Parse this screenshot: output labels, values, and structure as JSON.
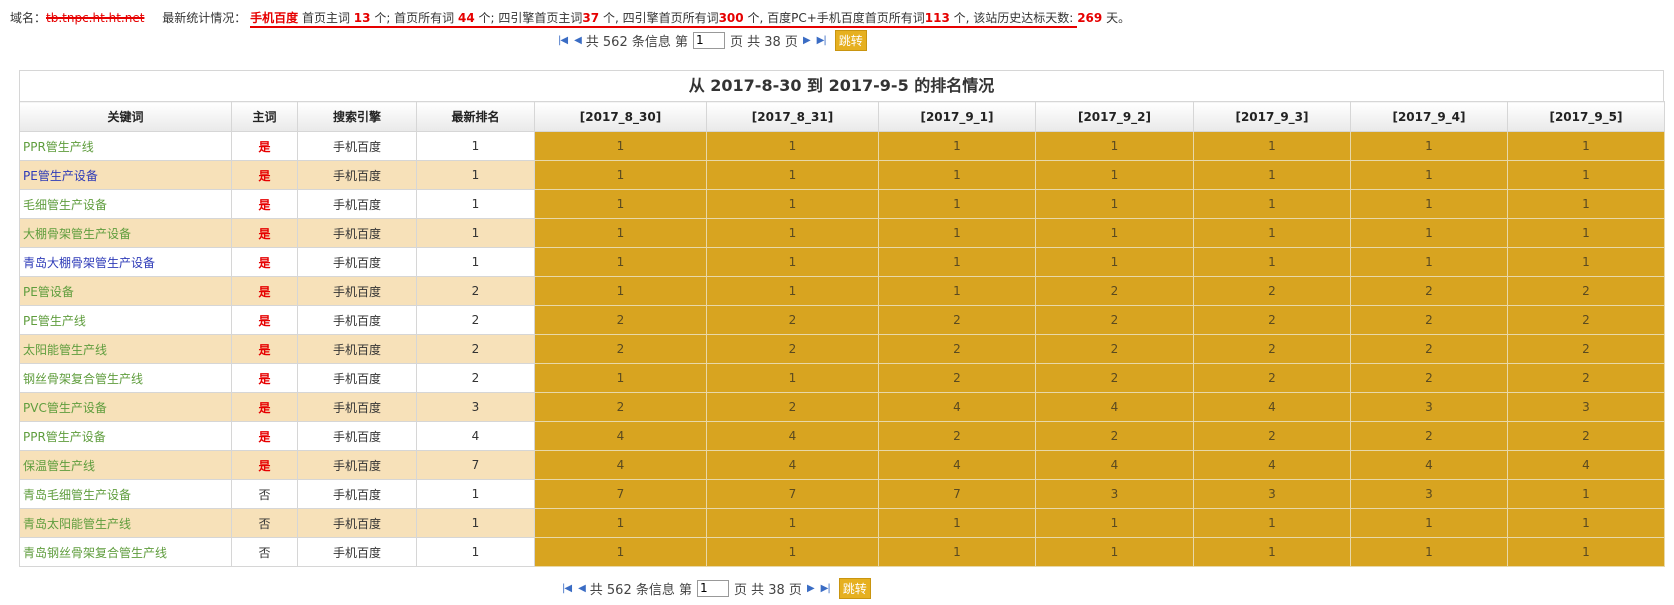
{
  "stats": {
    "domain_label": "域名：",
    "domain_value": "tb.tnpc.ht.ht.net",
    "summary_label": "最新统计情况：",
    "engine": "手机百度",
    "home_main_text": "首页主词",
    "home_main_count": "13",
    "unit1": "个; 首页所有词",
    "home_all_count": "44",
    "unit2": "个; 四引擎首页主词",
    "four_main_count": "37",
    "unit3": "个, 四引擎首页所有词",
    "four_all_count": "300",
    "unit4": "个, 百度PC+手机百度首页所有词",
    "pc_mobile_count": "113",
    "unit5": "个, 该站历史达标天数:",
    "days": "269",
    "days_unit": "天。"
  },
  "pager": {
    "first_icon": "first-page-icon",
    "prev_icon": "prev-page-icon",
    "next_icon": "next-page-icon",
    "last_icon": "last-page-icon",
    "total_text": "共 562 条信息 第",
    "page_value": "1",
    "pages_text": "页 共 38 页",
    "go_label": "跳转"
  },
  "table": {
    "caption": "从 2017-8-30 到 2017-9-5 的排名情况",
    "headers": [
      "关键词",
      "主词",
      "搜索引擎",
      "最新排名",
      "[2017_8_30]",
      "[2017_8_31]",
      "[2017_9_1]",
      "[2017_9_2]",
      "[2017_9_3]",
      "[2017_9_4]",
      "[2017_9_5]"
    ],
    "rows": [
      {
        "keyword": "PPR管生产线",
        "color": "green",
        "main": "是",
        "engine": "手机百度",
        "latest": "1",
        "ranks": [
          "1",
          "1",
          "1",
          "1",
          "1",
          "1",
          "1"
        ]
      },
      {
        "keyword": "PE管生产设备",
        "color": "blue",
        "main": "是",
        "engine": "手机百度",
        "latest": "1",
        "ranks": [
          "1",
          "1",
          "1",
          "1",
          "1",
          "1",
          "1"
        ]
      },
      {
        "keyword": "毛细管生产设备",
        "color": "green",
        "main": "是",
        "engine": "手机百度",
        "latest": "1",
        "ranks": [
          "1",
          "1",
          "1",
          "1",
          "1",
          "1",
          "1"
        ]
      },
      {
        "keyword": "大棚骨架管生产设备",
        "color": "green",
        "main": "是",
        "engine": "手机百度",
        "latest": "1",
        "ranks": [
          "1",
          "1",
          "1",
          "1",
          "1",
          "1",
          "1"
        ]
      },
      {
        "keyword": "青岛大棚骨架管生产设备",
        "color": "blue",
        "main": "是",
        "engine": "手机百度",
        "latest": "1",
        "ranks": [
          "1",
          "1",
          "1",
          "1",
          "1",
          "1",
          "1"
        ]
      },
      {
        "keyword": "PE管设备",
        "color": "green",
        "main": "是",
        "engine": "手机百度",
        "latest": "2",
        "ranks": [
          "1",
          "1",
          "1",
          "2",
          "2",
          "2",
          "2"
        ]
      },
      {
        "keyword": "PE管生产线",
        "color": "green",
        "main": "是",
        "engine": "手机百度",
        "latest": "2",
        "ranks": [
          "2",
          "2",
          "2",
          "2",
          "2",
          "2",
          "2"
        ]
      },
      {
        "keyword": "太阳能管生产线",
        "color": "green",
        "main": "是",
        "engine": "手机百度",
        "latest": "2",
        "ranks": [
          "2",
          "2",
          "2",
          "2",
          "2",
          "2",
          "2"
        ]
      },
      {
        "keyword": "钢丝骨架复合管生产线",
        "color": "green",
        "main": "是",
        "engine": "手机百度",
        "latest": "2",
        "ranks": [
          "1",
          "1",
          "2",
          "2",
          "2",
          "2",
          "2"
        ]
      },
      {
        "keyword": "PVC管生产设备",
        "color": "green",
        "main": "是",
        "engine": "手机百度",
        "latest": "3",
        "ranks": [
          "2",
          "2",
          "4",
          "4",
          "4",
          "3",
          "3"
        ]
      },
      {
        "keyword": "PPR管生产设备",
        "color": "green",
        "main": "是",
        "engine": "手机百度",
        "latest": "4",
        "ranks": [
          "4",
          "4",
          "2",
          "2",
          "2",
          "2",
          "2"
        ]
      },
      {
        "keyword": "保温管生产线",
        "color": "green",
        "main": "是",
        "engine": "手机百度",
        "latest": "7",
        "ranks": [
          "4",
          "4",
          "4",
          "4",
          "4",
          "4",
          "4"
        ]
      },
      {
        "keyword": "青岛毛细管生产设备",
        "color": "green",
        "main": "否",
        "engine": "手机百度",
        "latest": "1",
        "ranks": [
          "7",
          "7",
          "7",
          "3",
          "3",
          "3",
          "1"
        ]
      },
      {
        "keyword": "青岛太阳能管生产线",
        "color": "green",
        "main": "否",
        "engine": "手机百度",
        "latest": "1",
        "ranks": [
          "1",
          "1",
          "1",
          "1",
          "1",
          "1",
          "1"
        ]
      },
      {
        "keyword": "青岛钢丝骨架复合管生产线",
        "color": "green",
        "main": "否",
        "engine": "手机百度",
        "latest": "1",
        "ranks": [
          "1",
          "1",
          "1",
          "1",
          "1",
          "1",
          "1"
        ]
      }
    ]
  },
  "colors": {
    "rank_cell": "#d8a420",
    "even_row": "#f7e1b9",
    "highlight_red": "#e60000"
  }
}
